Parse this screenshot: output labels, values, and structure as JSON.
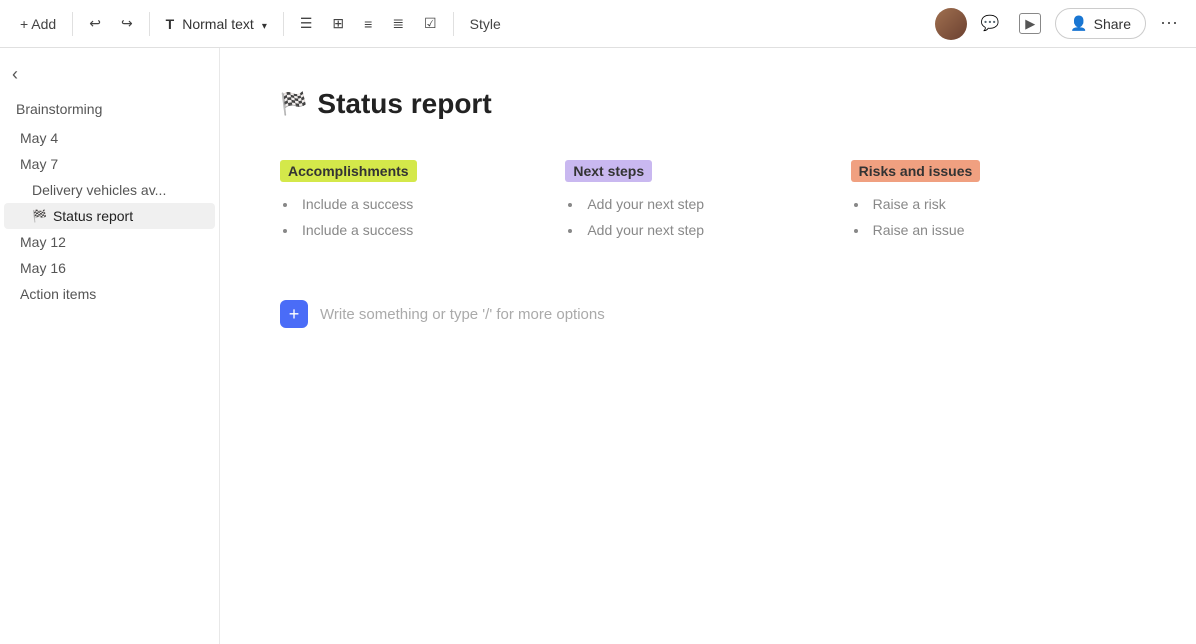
{
  "toolbar": {
    "add_label": "+ Add",
    "undo_title": "Undo",
    "redo_title": "Redo",
    "text_style": "Normal text",
    "align_title": "Align",
    "columns_title": "Columns",
    "bullet_title": "Bullet list",
    "numbered_title": "Numbered list",
    "checklist_title": "Checklist",
    "style_label": "Style",
    "share_label": "Share"
  },
  "sidebar": {
    "toggle_title": "Collapse sidebar",
    "section_title": "Brainstorming",
    "items": [
      {
        "label": "May 4",
        "type": "date",
        "active": false,
        "sub": false
      },
      {
        "label": "May 7",
        "type": "date",
        "active": false,
        "sub": false
      },
      {
        "label": "Delivery vehicles av...",
        "type": "doc",
        "active": false,
        "sub": true
      },
      {
        "label": "Status report",
        "type": "doc",
        "active": true,
        "sub": true
      },
      {
        "label": "May 12",
        "type": "date",
        "active": false,
        "sub": false
      },
      {
        "label": "May 16",
        "type": "date",
        "active": false,
        "sub": false
      },
      {
        "label": "Action items",
        "type": "doc",
        "active": false,
        "sub": false
      }
    ]
  },
  "page": {
    "title_icon": "🏁",
    "title": "Status report",
    "columns": [
      {
        "key": "accomplishments",
        "header": "Accomplishments",
        "header_class": "accomplishments",
        "items": [
          "Include a success",
          "Include a success"
        ]
      },
      {
        "key": "next-steps",
        "header": "Next steps",
        "header_class": "next-steps",
        "items": [
          "Add your next step",
          "Add your next step"
        ]
      },
      {
        "key": "risks",
        "header": "Risks and issues",
        "header_class": "risks",
        "items": [
          "Raise a risk",
          "Raise an issue"
        ]
      }
    ],
    "write_prompt": "Write something or type '/' for more options"
  }
}
